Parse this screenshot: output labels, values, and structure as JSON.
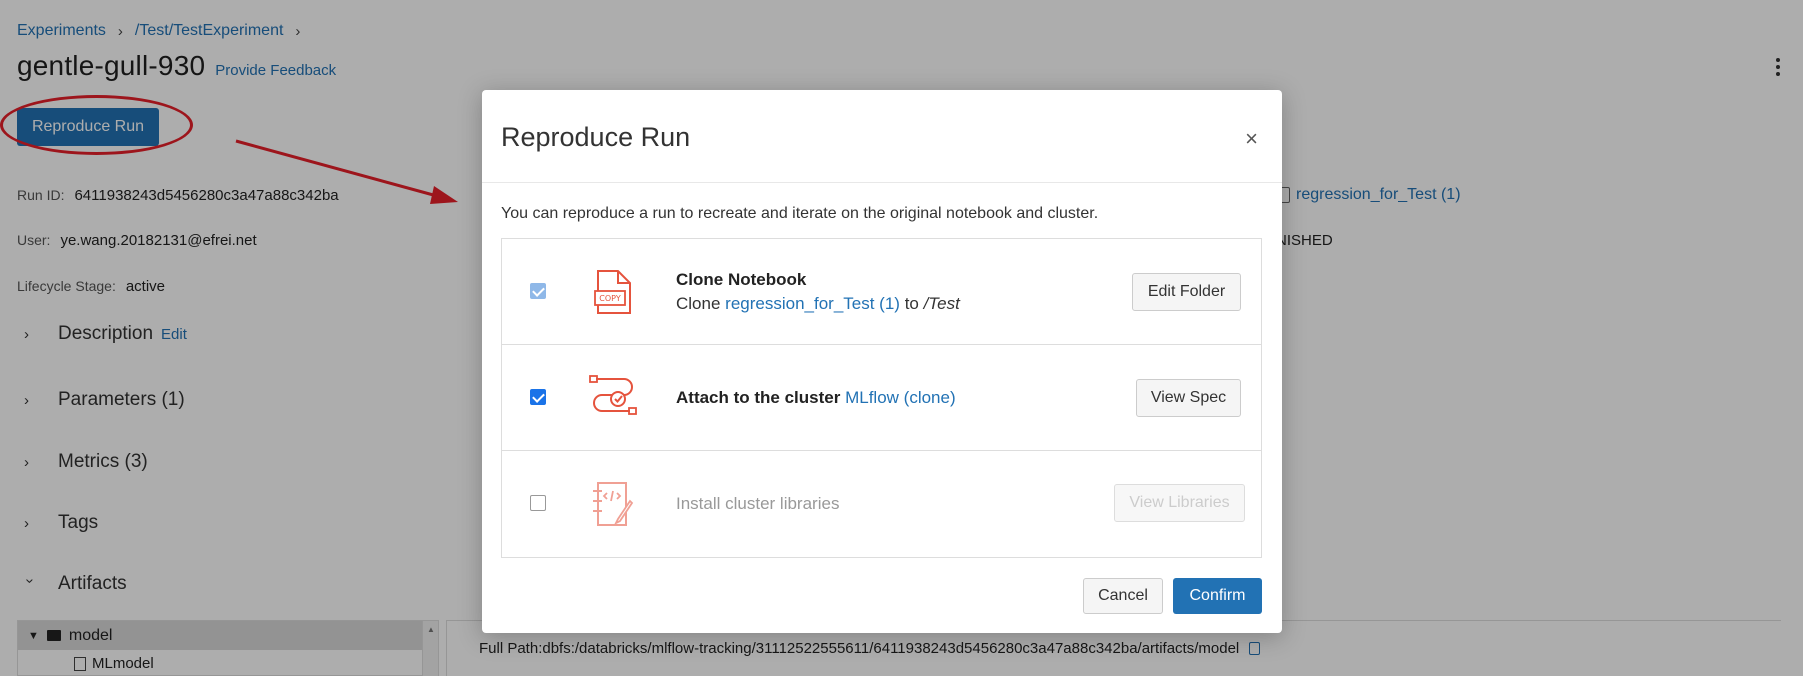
{
  "breadcrumb": {
    "item1": "Experiments",
    "item2": "/Test/TestExperiment"
  },
  "header": {
    "title": "gentle-gull-930",
    "feedback_link": "Provide Feedback",
    "reproduce_button": "Reproduce Run"
  },
  "meta": {
    "run_id_label": "Run ID:",
    "run_id": "6411938243d5456280c3a47a88c342ba",
    "user_label": "User:",
    "user": "ye.wang.20182131@efrei.net",
    "lifecycle_label": "Lifecycle Stage:",
    "lifecycle": "active",
    "source_link": "regression_for_Test (1)",
    "status_partial": "NISHED"
  },
  "sections": {
    "description": "Description",
    "edit": "Edit",
    "parameters": "Parameters (1)",
    "metrics": "Metrics (3)",
    "tags": "Tags",
    "artifacts": "Artifacts"
  },
  "artifacts": {
    "folder": "model",
    "file": "MLmodel",
    "full_path": "Full Path:dbfs:/databricks/mlflow-tracking/31112522555611/6411938243d5456280c3a47a88c342ba/artifacts/model"
  },
  "modal": {
    "title": "Reproduce Run",
    "close": "×",
    "description": "You can reproduce a run to recreate and iterate on the original notebook and cluster.",
    "option1": {
      "heading": "Clone Notebook",
      "prefix": "Clone",
      "notebook_link": "regression_for_Test (1)",
      "to": "to",
      "target_path": "/Test",
      "button": "Edit Folder",
      "checked": true
    },
    "option2": {
      "text": "Attach to the cluster",
      "cluster_link": "MLflow (clone)",
      "button": "View Spec",
      "checked": true
    },
    "option3": {
      "text": "Install cluster libraries",
      "button": "View Libraries",
      "checked": false
    },
    "cancel": "Cancel",
    "confirm": "Confirm"
  },
  "icons": {
    "copy_notebook_label": "COPY",
    "copy_notebook": "copy-notebook-icon",
    "cluster": "cluster-icon",
    "libraries": "libraries-icon",
    "accent": "#e5533d"
  },
  "colors": {
    "primary": "#2272b4",
    "annotation_red": "#e8202a"
  }
}
